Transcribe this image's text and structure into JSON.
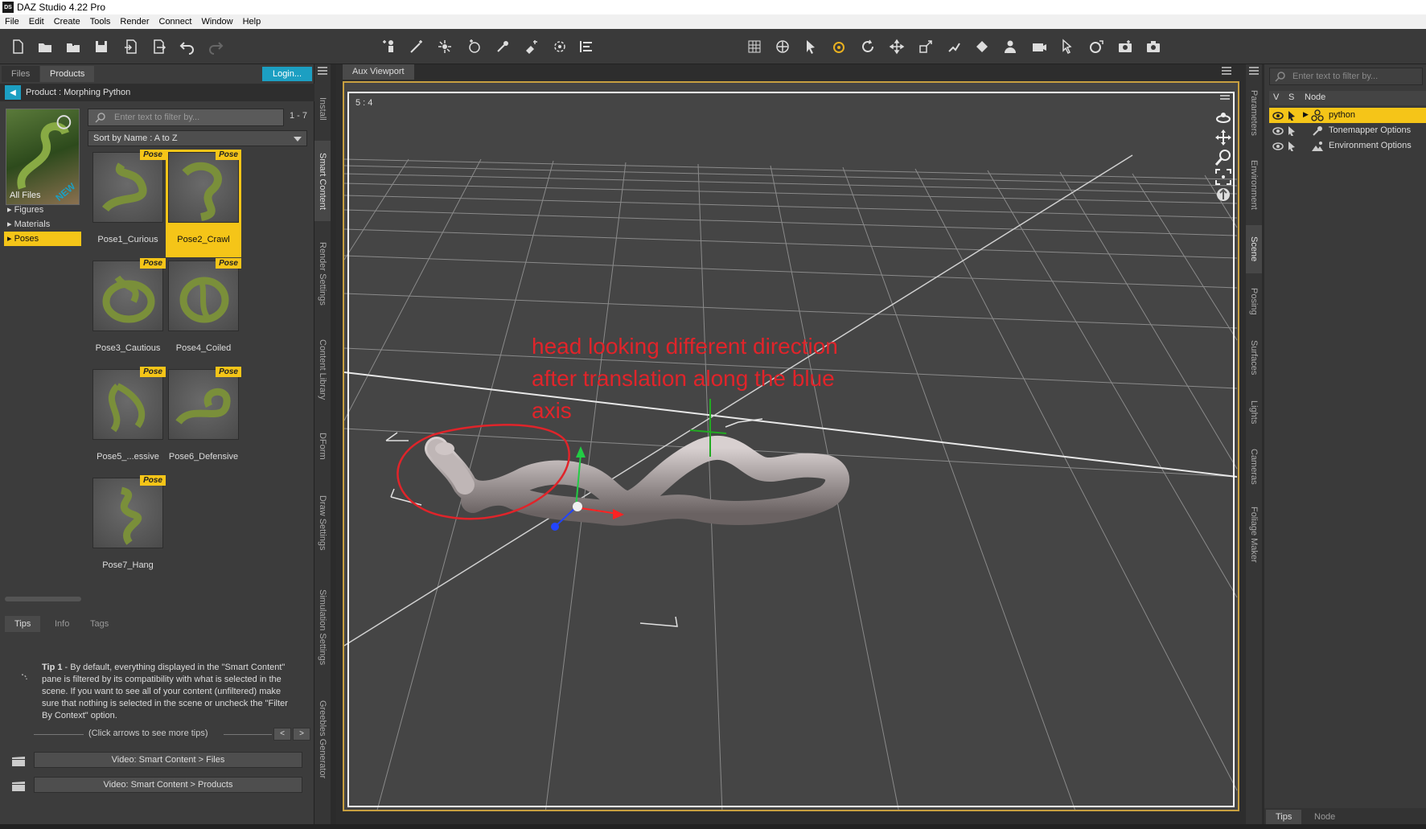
{
  "window": {
    "title": "DAZ Studio 4.22 Pro",
    "app_icon": "DS"
  },
  "menu": [
    "File",
    "Edit",
    "Create",
    "Tools",
    "Render",
    "Connect",
    "Window",
    "Help"
  ],
  "left_panel": {
    "tabs": [
      "Files",
      "Products"
    ],
    "login_label": "Login...",
    "product_title": "Product :  Morphing Python",
    "all_files_label": "All Files",
    "categories": [
      {
        "label": "Figures",
        "expanded": false,
        "selected": false
      },
      {
        "label": "Materials",
        "expanded": false,
        "selected": false
      },
      {
        "label": "Poses",
        "expanded": false,
        "selected": true
      }
    ],
    "search_placeholder": "Enter text to filter by...",
    "count": "1 - 7",
    "sort_label": "Sort by Name : A to Z",
    "badge_text": "Pose",
    "items": [
      {
        "label": "Pose1_Curious",
        "selected": false
      },
      {
        "label": "Pose2_Crawl",
        "selected": true
      },
      {
        "label": "Pose3_Cautious",
        "selected": false
      },
      {
        "label": "Pose4_Coiled",
        "selected": false
      },
      {
        "label": "Pose5_...essive",
        "selected": false
      },
      {
        "label": "Pose6_Defensive",
        "selected": false
      },
      {
        "label": "Pose7_Hang",
        "selected": false
      }
    ]
  },
  "tips": {
    "tabs": [
      "Tips",
      "Info",
      "Tags"
    ],
    "tip_title": "Tip 1",
    "tip_body": " - By default, everything displayed in the \"Smart Content\" pane is filtered by its compatibility with what is selected in the scene. If you want to see all of your content (unfiltered) make sure that nothing is selected in the scene or uncheck the \"Filter By Context\" option.",
    "nav_text": "(Click arrows to see more tips)",
    "prev": "<",
    "next": ">",
    "video_buttons": [
      "Video: Smart Content > Files",
      "Video: Smart Content > Products"
    ]
  },
  "left_side_tabs": [
    "Install",
    "Smart Content",
    "Render Settings",
    "Content Library",
    "DForm",
    "Draw Settings",
    "Simulation Settings",
    "Greebles Generator"
  ],
  "viewport": {
    "tab": "Aux Viewport",
    "ratio": "5 : 4",
    "annotation": [
      "head looking different direction",
      "after translation along the blue",
      "axis"
    ]
  },
  "right_side_tabs": [
    "Parameters",
    "Environment",
    "Scene",
    "Posing",
    "Surfaces",
    "Lights",
    "Cameras",
    "Foliage Maker"
  ],
  "scene": {
    "search_placeholder": "Enter text to filter by...",
    "columns": [
      "V",
      "S",
      "Node"
    ],
    "nodes": [
      {
        "label": "python",
        "selected": true,
        "icon": "figure-icon"
      },
      {
        "label": "Tonemapper Options",
        "selected": false,
        "icon": "tonemapper-icon"
      },
      {
        "label": "Environment Options",
        "selected": false,
        "icon": "environment-icon"
      }
    ],
    "bottom_tabs": [
      "Tips",
      "Node"
    ]
  },
  "colors": {
    "accent_yellow": "#f5c518",
    "accent_blue": "#1c9fc2",
    "annotation_red": "#e0242a"
  }
}
